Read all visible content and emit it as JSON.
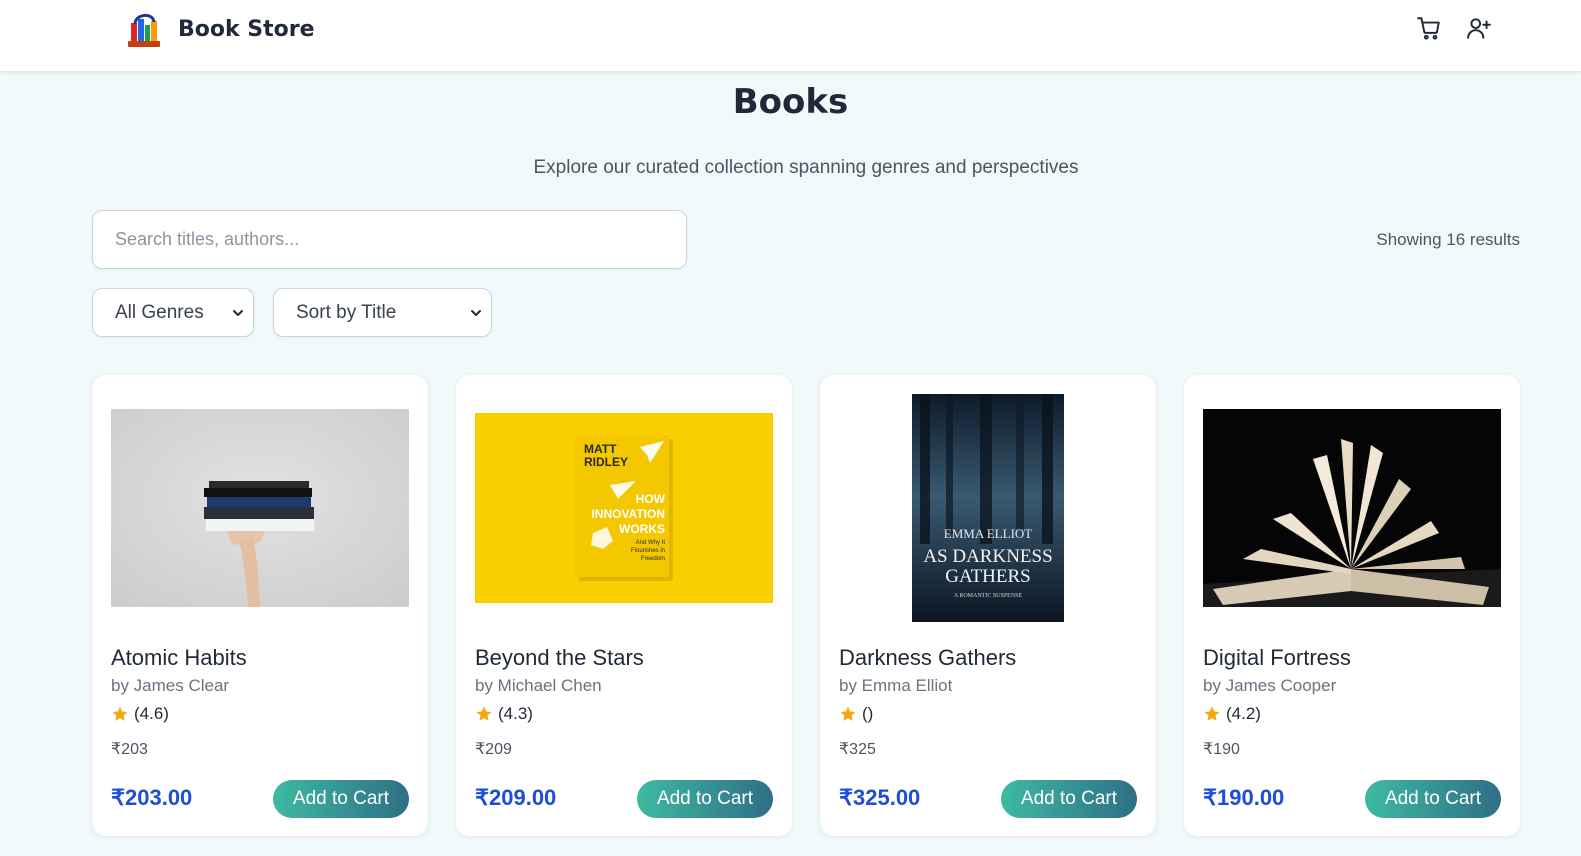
{
  "nav": {
    "brand": "Book Store",
    "logo_icon": "bookshelf-logo-icon",
    "icons": [
      "cart-icon",
      "add-user-icon"
    ]
  },
  "header": {
    "title": "Books",
    "subtitle": "Explore our curated collection spanning genres and perspectives"
  },
  "search": {
    "placeholder": "Search titles, authors...",
    "value": "",
    "results_text": "Showing 16 results"
  },
  "filters": {
    "genre_selected": "All Genres",
    "sort_selected": "Sort by Title"
  },
  "colors": {
    "price": "#1d4ed8",
    "star": "#f5a70d",
    "button_start": "#3ebaa1",
    "button_end": "#2f6f86",
    "page_bg": "#f1fafa"
  },
  "books": [
    {
      "title": "Atomic Habits",
      "author": "by James Clear",
      "rating": "(4.6)",
      "small_price": "₹203",
      "price": "₹203.00",
      "button": "Add to Cart",
      "cover_desc": "hand holding stack of books"
    },
    {
      "title": "Beyond the Stars",
      "author": "by Michael Chen",
      "rating": "(4.3)",
      "small_price": "₹209",
      "price": "₹209.00",
      "button": "Add to Cart",
      "cover_text": {
        "author_line1": "MATT",
        "author_line2": "RIDLEY",
        "title_line1": "HOW",
        "title_line2": "INNOVATION",
        "title_line3": "WORKS",
        "subtitle_line1": "And Why It",
        "subtitle_line2": "Flourishes in",
        "subtitle_line3": "Freedom"
      }
    },
    {
      "title": "Darkness Gathers",
      "author": "by Emma Elliot",
      "rating": "()",
      "small_price": "₹325",
      "price": "₹325.00",
      "button": "Add to Cart",
      "cover_text": {
        "author": "EMMA ELLIOT",
        "title_line1": "AS DARKNESS",
        "title_line2": "GATHERS",
        "tagline": "A ROMANTIC SUSPENSE"
      }
    },
    {
      "title": "Digital Fortress",
      "author": "by James Cooper",
      "rating": "(4.2)",
      "small_price": "₹190",
      "price": "₹190.00",
      "button": "Add to Cart",
      "cover_desc": "open book on dark background"
    }
  ]
}
